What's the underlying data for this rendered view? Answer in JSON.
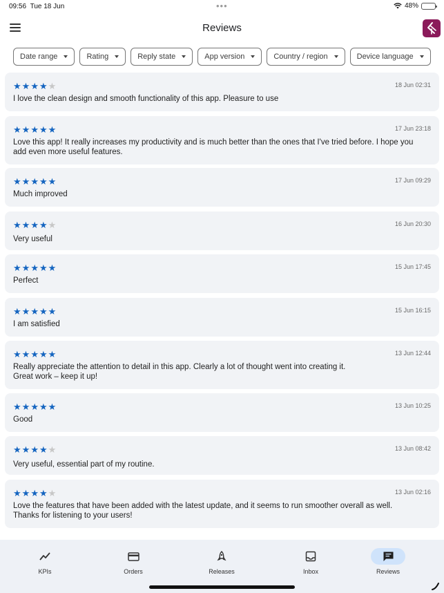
{
  "status_bar": {
    "time": "09:56",
    "date": "Tue 18 Jun",
    "battery": "48%",
    "battery_level": 0.48
  },
  "header": {
    "title": "Reviews"
  },
  "filters": [
    {
      "label": "Date range"
    },
    {
      "label": "Rating"
    },
    {
      "label": "Reply state"
    },
    {
      "label": "App version"
    },
    {
      "label": "Country / region"
    },
    {
      "label": "Device language"
    }
  ],
  "reviews": [
    {
      "rating": 4,
      "date": "18 Jun 02:31",
      "text": "I love the clean design and smooth functionality of this app. Pleasure to use"
    },
    {
      "rating": 5,
      "date": "17 Jun 23:18",
      "text": "Love this app! It really increases my productivity and is much better than the ones that I've tried before. I hope you add even more useful features."
    },
    {
      "rating": 5,
      "date": "17 Jun 09:29",
      "text": "Much improved"
    },
    {
      "rating": 4,
      "date": "16 Jun 20:30",
      "text": "Very useful"
    },
    {
      "rating": 5,
      "date": "15 Jun 17:45",
      "text": "Perfect"
    },
    {
      "rating": 5,
      "date": "15 Jun 16:15",
      "text": "I am satisfied"
    },
    {
      "rating": 5,
      "date": "13 Jun 12:44",
      "text": "Really appreciate the attention to detail in this app. Clearly a lot of thought went into creating it.\nGreat work – keep it up!"
    },
    {
      "rating": 5,
      "date": "13 Jun 10:25",
      "text": "Good"
    },
    {
      "rating": 4,
      "date": "13 Jun 08:42",
      "text": "Very useful, essential part of my routine."
    },
    {
      "rating": 4,
      "date": "13 Jun 02:16",
      "text": "Love the features that have been added with the latest update, and it seems to run smoother overall as well.\nThanks for listening to your users!"
    }
  ],
  "bottom_nav": [
    {
      "label": "KPIs",
      "icon": "trend-icon",
      "active": false
    },
    {
      "label": "Orders",
      "icon": "card-icon",
      "active": false
    },
    {
      "label": "Releases",
      "icon": "rocket-icon",
      "active": false
    },
    {
      "label": "Inbox",
      "icon": "inbox-icon",
      "active": false
    },
    {
      "label": "Reviews",
      "icon": "review-icon",
      "active": true
    }
  ],
  "colors": {
    "star": "#1565c0",
    "star_empty": "#c7c7c7",
    "card_bg": "#f1f3f6",
    "nav_bg": "#eef1f6",
    "nav_active": "#cfe3fb",
    "logo_bg": "#8b1a5a"
  }
}
